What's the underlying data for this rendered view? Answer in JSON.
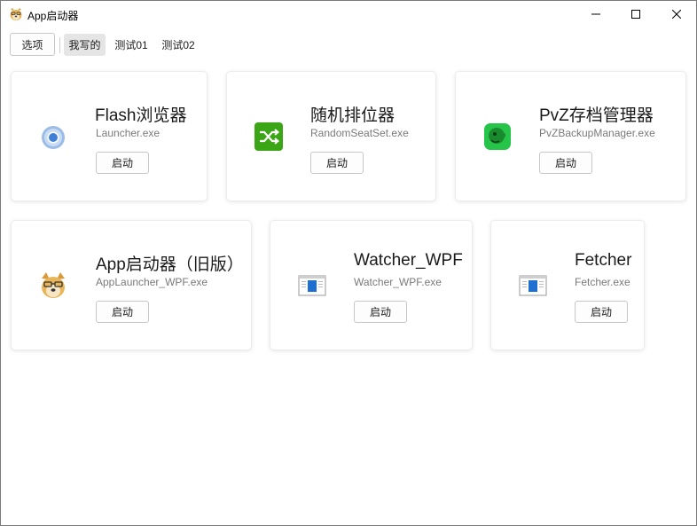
{
  "window": {
    "title": "App启动器"
  },
  "toolbar": {
    "options_label": "选项",
    "tabs": [
      {
        "label": "我写的",
        "active": true
      },
      {
        "label": "测试01",
        "active": false
      },
      {
        "label": "测试02",
        "active": false
      }
    ]
  },
  "apps": [
    {
      "name": "Flash浏览器",
      "exe": "Launcher.exe",
      "launch_label": "启动",
      "icon": "chrome-globe-icon"
    },
    {
      "name": "随机排位器",
      "exe": "RandomSeatSet.exe",
      "launch_label": "启动",
      "icon": "shuffle-icon"
    },
    {
      "name": "PvZ存档管理器",
      "exe": "PvZBackupManager.exe",
      "launch_label": "启动",
      "icon": "peashooter-icon"
    },
    {
      "name": "App启动器（旧版）",
      "exe": "AppLauncher_WPF.exe",
      "launch_label": "启动",
      "icon": "doge-icon"
    },
    {
      "name": "Watcher_WPF",
      "exe": "Watcher_WPF.exe",
      "launch_label": "启动",
      "icon": "app-window-icon"
    },
    {
      "name": "Fetcher",
      "exe": "Fetcher.exe",
      "launch_label": "启动",
      "icon": "app-window-icon"
    }
  ],
  "colors": {
    "shuffle_green": "#3aa515",
    "peashooter_green": "#27c44a",
    "window_blue": "#1e6fd0"
  }
}
